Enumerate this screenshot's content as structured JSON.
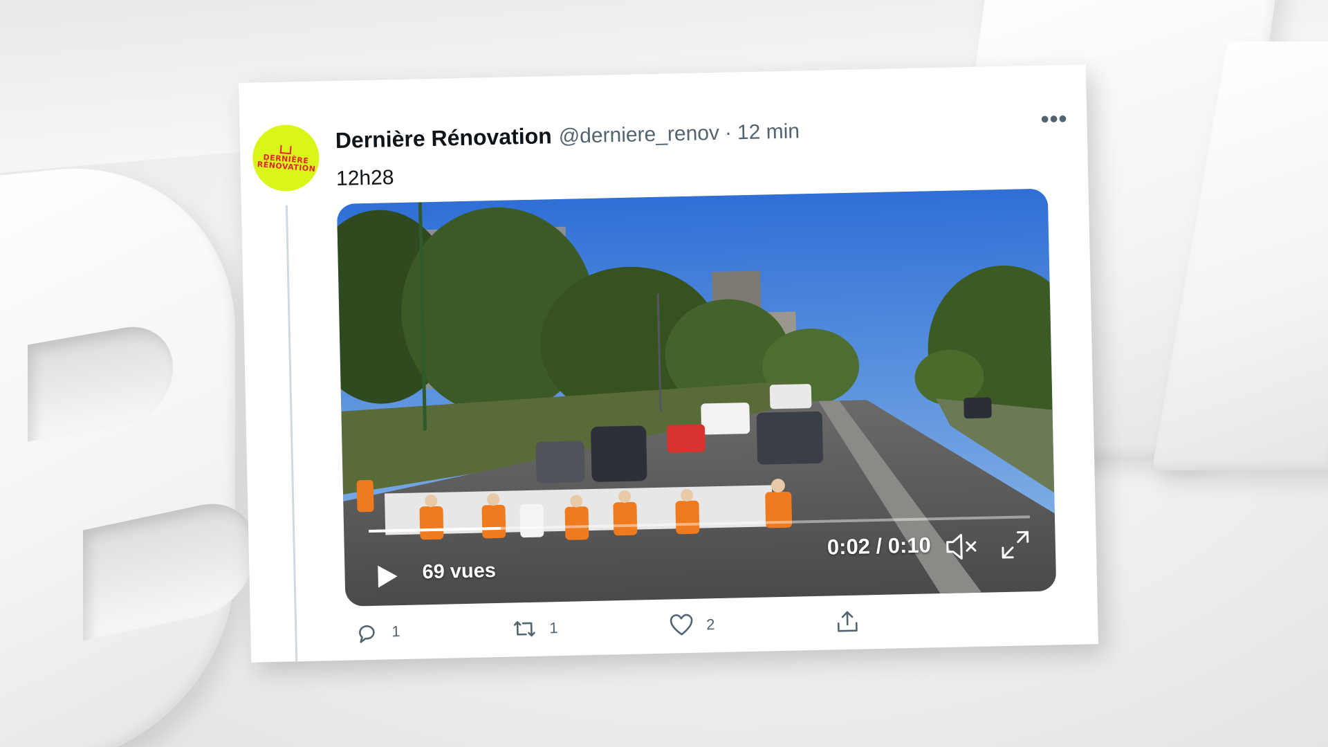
{
  "tweet": {
    "author_name": "Dernière Rénovation",
    "handle": "@derniere_renov",
    "separator": "·",
    "time_ago": "12 min",
    "more_icon": "more-horizontal-icon",
    "text": "12h28",
    "avatar": {
      "logo_text_line1": "DERNIÈRE",
      "logo_text_line2": "RÉNOVATION",
      "bg_color": "#d9f51a",
      "logo_color": "#e0262f"
    }
  },
  "video": {
    "views_label": "69 vues",
    "timecode": "0:02 / 0:10",
    "progress_fraction": 0.2,
    "play_icon": "play-icon",
    "mute_icon": "muted-speaker-icon",
    "fullscreen_icon": "fullscreen-icon"
  },
  "actions": {
    "reply": {
      "icon": "reply-icon",
      "count": "1"
    },
    "retweet": {
      "icon": "retweet-icon",
      "count": "1"
    },
    "like": {
      "icon": "heart-icon",
      "count": "2"
    },
    "share": {
      "icon": "share-icon"
    }
  },
  "colors": {
    "text_primary": "#0f1419",
    "text_secondary": "#536471"
  }
}
